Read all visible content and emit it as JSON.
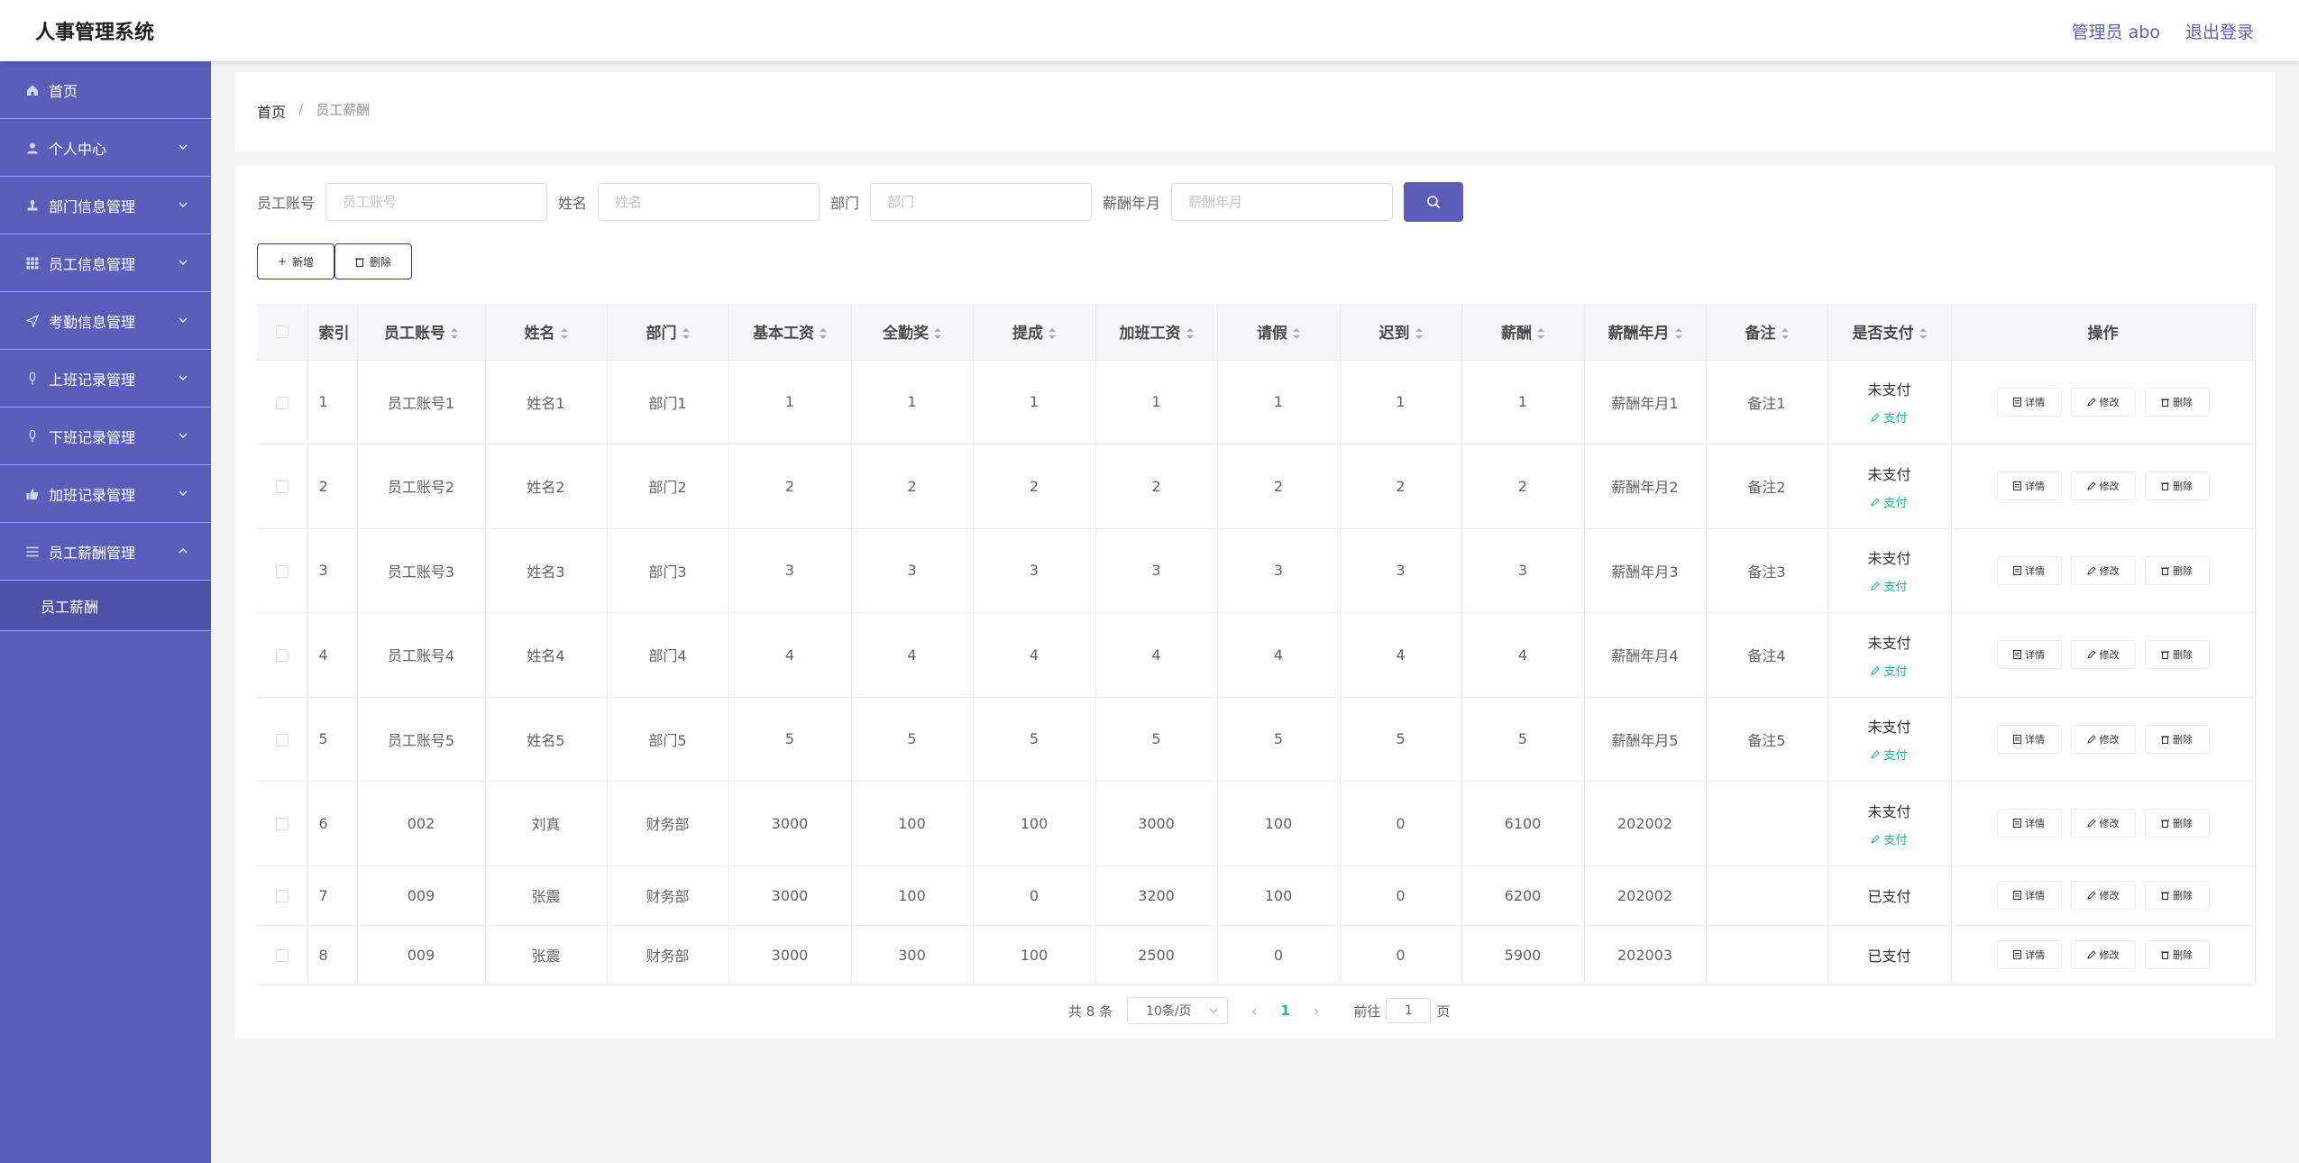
{
  "header": {
    "title": "人事管理系统",
    "user": "管理员 abo",
    "logout": "退出登录"
  },
  "sidebar": {
    "items": [
      {
        "label": "首页",
        "icon": "home-icon",
        "expandable": false
      },
      {
        "label": "个人中心",
        "icon": "user-icon",
        "expandable": true
      },
      {
        "label": "部门信息管理",
        "icon": "stamp-icon",
        "expandable": true
      },
      {
        "label": "员工信息管理",
        "icon": "grid-icon",
        "expandable": true
      },
      {
        "label": "考勤信息管理",
        "icon": "send-icon",
        "expandable": true
      },
      {
        "label": "上班记录管理",
        "icon": "mic-icon",
        "expandable": true
      },
      {
        "label": "下班记录管理",
        "icon": "mic-icon",
        "expandable": true
      },
      {
        "label": "加班记录管理",
        "icon": "thumb-icon",
        "expandable": true
      },
      {
        "label": "员工薪酬管理",
        "icon": "menu-icon",
        "expandable": true,
        "open": true
      }
    ],
    "sub_item": "员工薪酬"
  },
  "breadcrumb": {
    "home": "首页",
    "sep": "/",
    "current": "员工薪酬"
  },
  "search": {
    "fields": [
      {
        "label": "员工账号",
        "placeholder": "员工账号"
      },
      {
        "label": "姓名",
        "placeholder": "姓名"
      },
      {
        "label": "部门",
        "placeholder": "部门"
      },
      {
        "label": "薪酬年月",
        "placeholder": "薪酬年月"
      }
    ]
  },
  "toolbar": {
    "add_label": "新增",
    "delete_label": "删除"
  },
  "table": {
    "headers": [
      "索引",
      "员工账号",
      "姓名",
      "部门",
      "基本工资",
      "全勤奖",
      "提成",
      "加班工资",
      "请假",
      "迟到",
      "薪酬",
      "薪酬年月",
      "备注",
      "是否支付",
      "操作"
    ],
    "rows": [
      {
        "cells": [
          "1",
          "员工账号1",
          "姓名1",
          "部门1",
          "1",
          "1",
          "1",
          "1",
          "1",
          "1",
          "1",
          "薪酬年月1",
          "备注1"
        ],
        "status": "未支付",
        "pay": "支付"
      },
      {
        "cells": [
          "2",
          "员工账号2",
          "姓名2",
          "部门2",
          "2",
          "2",
          "2",
          "2",
          "2",
          "2",
          "2",
          "薪酬年月2",
          "备注2"
        ],
        "status": "未支付",
        "pay": "支付"
      },
      {
        "cells": [
          "3",
          "员工账号3",
          "姓名3",
          "部门3",
          "3",
          "3",
          "3",
          "3",
          "3",
          "3",
          "3",
          "薪酬年月3",
          "备注3"
        ],
        "status": "未支付",
        "pay": "支付"
      },
      {
        "cells": [
          "4",
          "员工账号4",
          "姓名4",
          "部门4",
          "4",
          "4",
          "4",
          "4",
          "4",
          "4",
          "4",
          "薪酬年月4",
          "备注4"
        ],
        "status": "未支付",
        "pay": "支付"
      },
      {
        "cells": [
          "5",
          "员工账号5",
          "姓名5",
          "部门5",
          "5",
          "5",
          "5",
          "5",
          "5",
          "5",
          "5",
          "薪酬年月5",
          "备注5"
        ],
        "status": "未支付",
        "pay": "支付"
      },
      {
        "cells": [
          "6",
          "002",
          "刘真",
          "财务部",
          "3000",
          "100",
          "100",
          "3000",
          "100",
          "0",
          "6100",
          "202002",
          ""
        ],
        "status": "未支付",
        "pay": "支付"
      },
      {
        "cells": [
          "7",
          "009",
          "张震",
          "财务部",
          "3000",
          "100",
          "0",
          "3200",
          "100",
          "0",
          "6200",
          "202002",
          ""
        ],
        "status": "已支付",
        "pay": ""
      },
      {
        "cells": [
          "8",
          "009",
          "张震",
          "财务部",
          "3000",
          "300",
          "100",
          "2500",
          "0",
          "0",
          "5900",
          "202003",
          ""
        ],
        "status": "已支付",
        "pay": ""
      }
    ],
    "actions": {
      "detail": "详情",
      "edit": "修改",
      "delete": "删除"
    }
  },
  "pagination": {
    "total": "共 8 条",
    "page_size": "10条/页",
    "current": "1",
    "goto": "前往",
    "page_value": "1",
    "page_suffix": "页"
  },
  "colors": {
    "primary": "#5a5eb9",
    "success": "#19b98b"
  }
}
